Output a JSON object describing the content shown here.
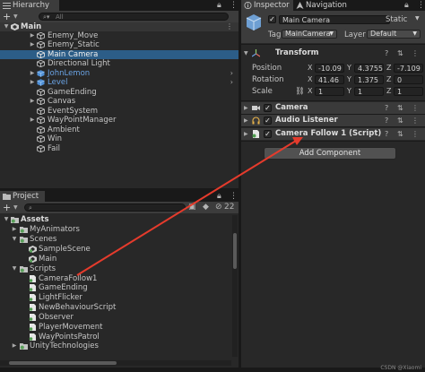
{
  "hierarchy": {
    "tab_label": "Hierarchy",
    "search_placeholder": "All",
    "scene": "Main",
    "items": [
      {
        "label": "Enemy_Move",
        "icon": "gameobject-icon"
      },
      {
        "label": "Enemy_Static",
        "icon": "gameobject-icon"
      },
      {
        "label": "Main Camera",
        "icon": "gameobject-icon"
      },
      {
        "label": "Directional Light",
        "icon": "gameobject-icon"
      },
      {
        "label": "JohnLemon",
        "icon": "prefab-icon"
      },
      {
        "label": "Level",
        "icon": "prefab-icon"
      },
      {
        "label": "GameEnding",
        "icon": "gameobject-icon"
      },
      {
        "label": "Canvas",
        "icon": "gameobject-icon"
      },
      {
        "label": "EventSystem",
        "icon": "gameobject-icon"
      },
      {
        "label": "WayPointManager",
        "icon": "gameobject-icon"
      },
      {
        "label": "Ambient",
        "icon": "gameobject-icon"
      },
      {
        "label": "Win",
        "icon": "gameobject-icon"
      },
      {
        "label": "Fail",
        "icon": "gameobject-icon"
      }
    ]
  },
  "inspector": {
    "tab_label": "Inspector",
    "nav_tab_label": "Navigation",
    "object_name": "Main Camera",
    "static_label": "Static",
    "tag_label": "Tag",
    "tag_value": "MainCamera",
    "layer_label": "Layer",
    "layer_value": "Default",
    "transform": {
      "title": "Transform",
      "position_label": "Position",
      "rotation_label": "Rotation",
      "scale_label": "Scale",
      "position": {
        "x": "-10.09",
        "y": "4.3755",
        "z": "-7.109"
      },
      "rotation": {
        "x": "41.46",
        "y": "1.375",
        "z": "0"
      },
      "scale": {
        "x": "1",
        "y": "1",
        "z": "1"
      }
    },
    "components": [
      {
        "title": "Camera",
        "icon": "camera-icon"
      },
      {
        "title": "Audio Listener",
        "icon": "headphones-icon"
      },
      {
        "title": "Camera Follow 1 (Script)",
        "icon": "script-icon"
      }
    ],
    "add_component_label": "Add Component"
  },
  "project": {
    "tab_label": "Project",
    "count_badge": "22",
    "items": [
      {
        "label": "Assets",
        "icon": "folder-icon",
        "bold": true
      },
      {
        "label": "MyAnimators",
        "icon": "folder-icon"
      },
      {
        "label": "Scenes",
        "icon": "folder-icon"
      },
      {
        "label": "SampleScene",
        "icon": "scene-icon"
      },
      {
        "label": "Main",
        "icon": "scene-icon"
      },
      {
        "label": "Scripts",
        "icon": "folder-icon"
      },
      {
        "label": "CameraFollow1",
        "icon": "script-icon"
      },
      {
        "label": "GameEnding",
        "icon": "script-icon"
      },
      {
        "label": "LightFlicker",
        "icon": "script-icon"
      },
      {
        "label": "NewBehaviourScript",
        "icon": "script-icon"
      },
      {
        "label": "Observer",
        "icon": "script-icon"
      },
      {
        "label": "PlayerMovement",
        "icon": "script-icon"
      },
      {
        "label": "WayPointsPatrol",
        "icon": "script-icon"
      },
      {
        "label": "UnityTechnologies",
        "icon": "folder-icon"
      }
    ]
  },
  "annotation": {
    "color": "#e53b2c"
  },
  "watermark": "CSDN @Xiaomi"
}
